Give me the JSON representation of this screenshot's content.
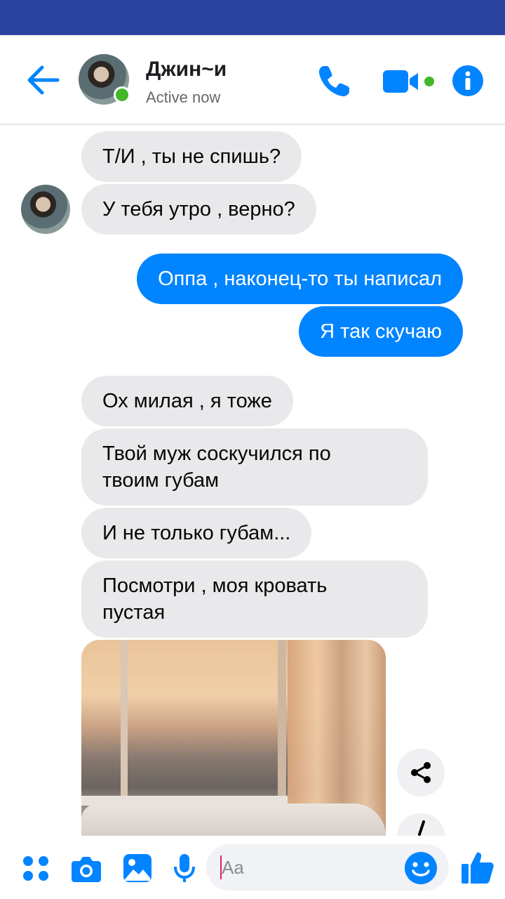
{
  "header": {
    "contact_name": "Джин~и",
    "status": "Active now",
    "colors": {
      "accent": "#0084ff",
      "online": "#42b72a",
      "status_bar": "#2a44a0"
    }
  },
  "messages": [
    {
      "direction": "incoming",
      "text": "Т/И , ты не спишь?"
    },
    {
      "direction": "incoming",
      "text": "У тебя утро , верно?"
    },
    {
      "direction": "outgoing",
      "text": "Оппа , наконец-то ты написал"
    },
    {
      "direction": "outgoing",
      "text": "Я так скучаю"
    },
    {
      "direction": "incoming",
      "text": "Ох милая , я тоже"
    },
    {
      "direction": "incoming",
      "text": "Твой муж соскучился по\nтвоим губам"
    },
    {
      "direction": "incoming",
      "text": "И не только губам..."
    },
    {
      "direction": "incoming",
      "text": "Посмотри , моя кровать\nпустая"
    }
  ],
  "photo_actions": [
    "share-icon",
    "download-icon"
  ],
  "composer": {
    "placeholder": "Aa",
    "icons": [
      "apps-icon",
      "camera-icon",
      "gallery-icon",
      "microphone-icon",
      "emoji-icon",
      "thumbs-up-icon"
    ]
  }
}
